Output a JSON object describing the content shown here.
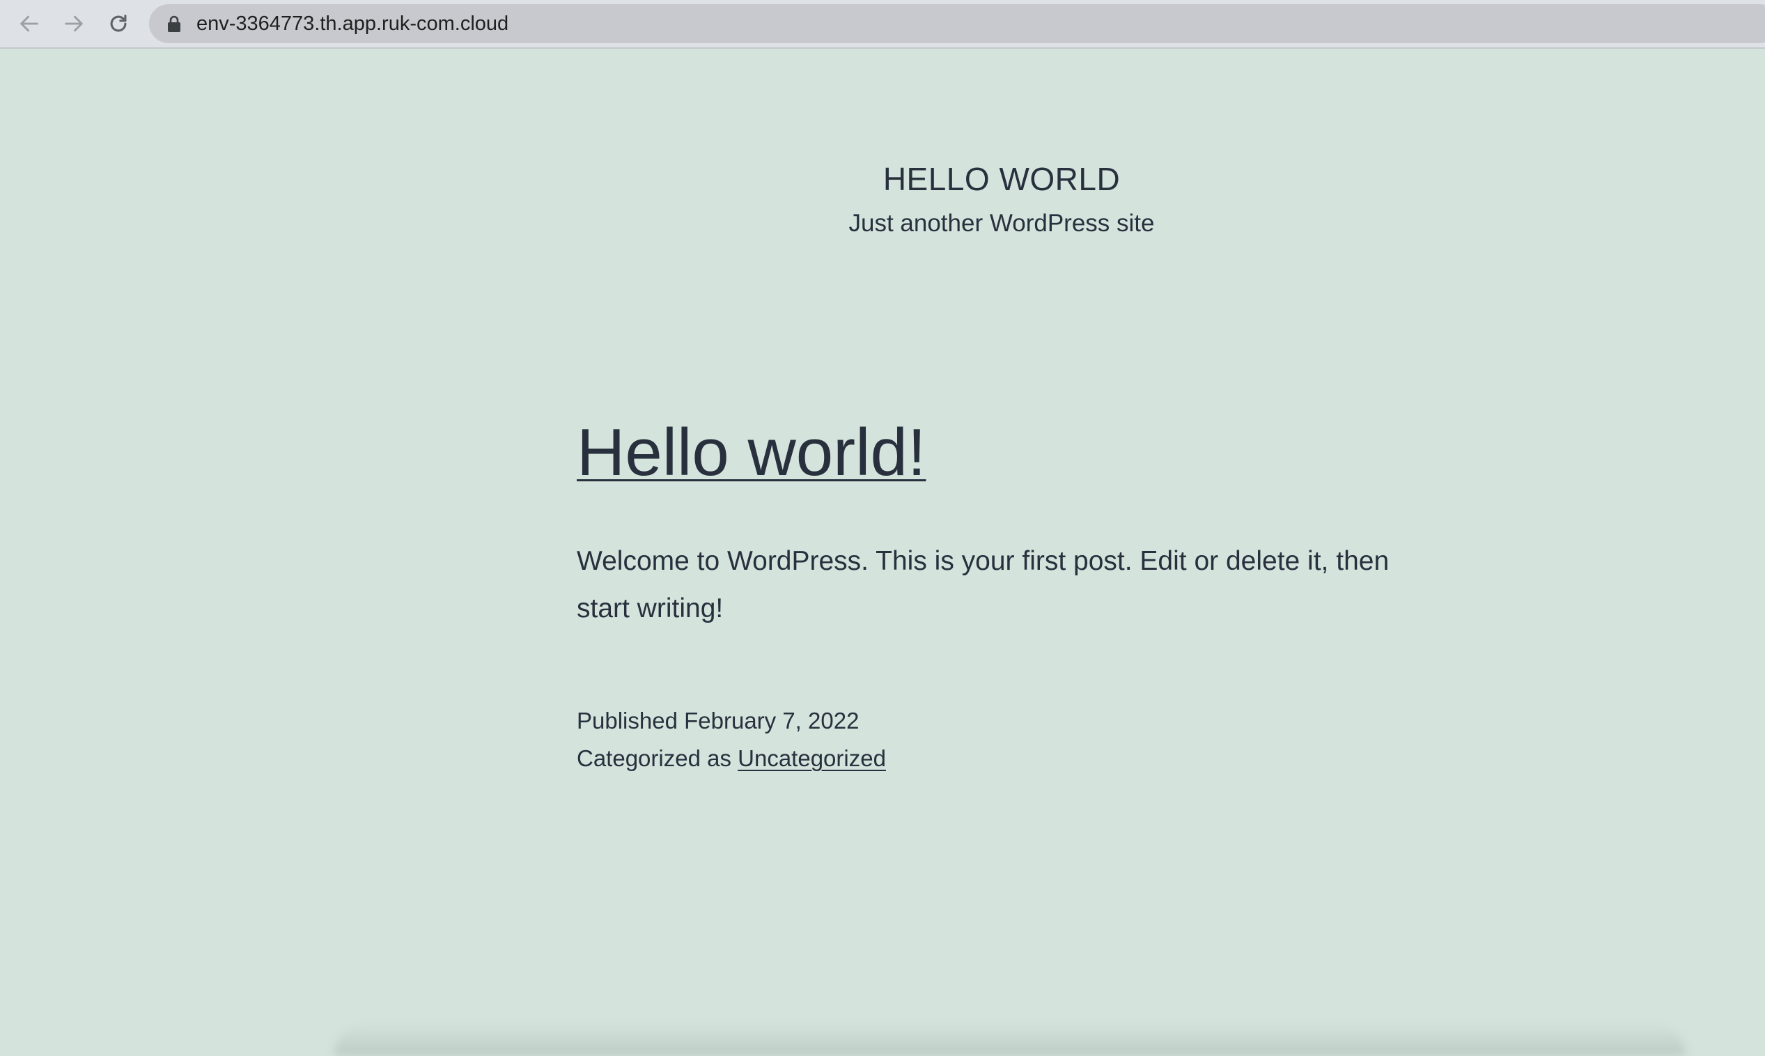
{
  "browser": {
    "url": "env-3364773.th.app.ruk-com.cloud",
    "icons": {
      "back": "arrow-left-icon",
      "forward": "arrow-right-icon",
      "reload": "reload-icon",
      "lock": "lock-icon"
    }
  },
  "site": {
    "title": "HELLO WORLD",
    "description": "Just another WordPress site"
  },
  "post": {
    "title": "Hello world!",
    "content": "Welcome to WordPress. This is your first post. Edit or delete it, then start writing!",
    "published_label": "Published February 7, 2022",
    "categorized_prefix": "Categorized as ",
    "category": "Uncategorized"
  },
  "colors": {
    "background": "#d4e3dc",
    "text": "#28303d",
    "toolbar": "#dee1e6"
  }
}
